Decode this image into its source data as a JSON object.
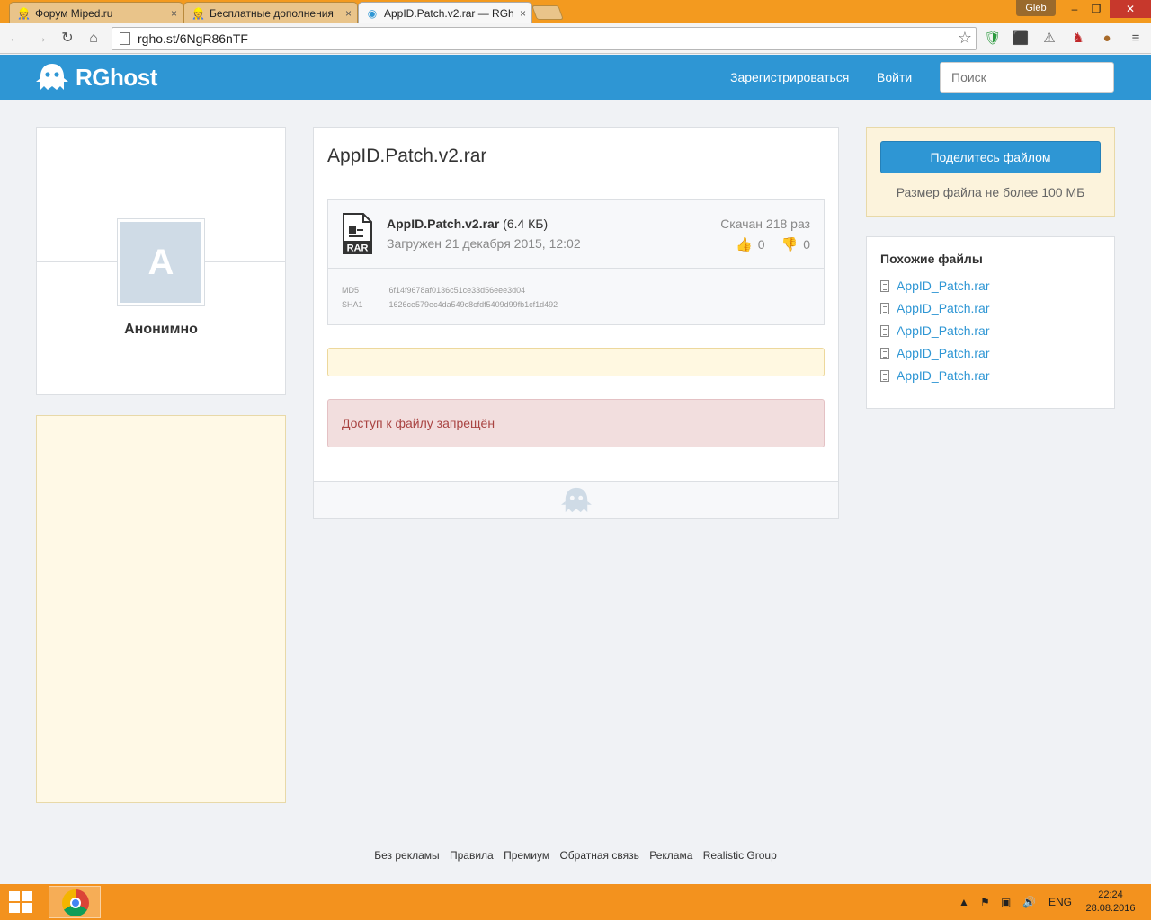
{
  "browser": {
    "tabs": [
      {
        "label": "Форум Miped.ru",
        "icon": "miped-favicon"
      },
      {
        "label": "Бесплатные дополнения",
        "icon": "miped-favicon"
      },
      {
        "label": "AppID.Patch.v2.rar — RGh",
        "icon": "rghost-favicon"
      }
    ],
    "user": "Gleb",
    "url": "rgho.st/6NgR86nTF",
    "win_minimize": "–",
    "win_restore": "❐",
    "win_close": "✕",
    "tab_close": "×"
  },
  "header": {
    "logo_text": "RGhost",
    "register": "Зарегистрироваться",
    "login": "Войти",
    "search_placeholder": "Поиск"
  },
  "user_card": {
    "avatar_letter": "A",
    "name": "Анонимно"
  },
  "file": {
    "title": "AppID.Patch.v2.rar",
    "name": "AppID.Patch.v2.rar",
    "size": "(6.4 КБ)",
    "uploaded": "Загружен 21 декабря 2015, 12:02",
    "downloads": "Скачан 218 раз",
    "likes": "0",
    "dislikes": "0",
    "md5_label": "MD5",
    "md5": "6f14f9678af0136c51ce33d56eee3d04",
    "sha1_label": "SHA1",
    "sha1": "1626ce579ec4da549c8cfdf5409d99fb1cf1d492",
    "denied": "Доступ к файлу запрещён"
  },
  "share": {
    "button": "Поделитесь файлом",
    "note": "Размер файла не более 100 МБ"
  },
  "similar": {
    "title": "Похожие файлы",
    "items": [
      "AppID_Patch.rar",
      "AppID_Patch.rar",
      "AppID_Patch.rar",
      "AppID_Patch.rar",
      "AppID_Patch.rar"
    ]
  },
  "footer": {
    "links": [
      "Без рекламы",
      "Правила",
      "Премиум",
      "Обратная связь",
      "Реклама",
      "Realistic Group"
    ]
  },
  "taskbar": {
    "lang": "ENG",
    "time": "22:24",
    "date": "28.08.2016"
  },
  "colors": {
    "brand_blue": "#2e96d4",
    "chrome_orange": "#f39a1f",
    "denied_text": "#a94442"
  }
}
